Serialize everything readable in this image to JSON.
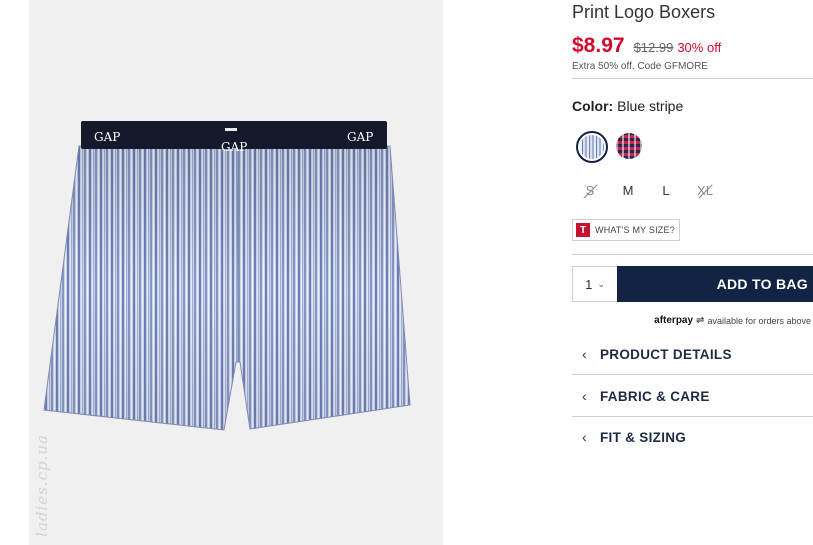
{
  "product": {
    "title": "Print Logo Boxers",
    "price": "$8.97",
    "original_price": "$12.99",
    "percent_off": "30% off",
    "promo": "Extra 50% off. Code GFMORE"
  },
  "image": {
    "waistband_text": [
      "GAP",
      "GAP",
      "GAP"
    ],
    "watermark": "ladies.cp.ua"
  },
  "color": {
    "label": "Color:",
    "value": "Blue stripe",
    "swatches": [
      {
        "name": "Blue stripe",
        "selected": true
      },
      {
        "name": "Plaid",
        "selected": false
      }
    ]
  },
  "sizes": [
    {
      "label": "S",
      "available": false
    },
    {
      "label": "M",
      "available": true
    },
    {
      "label": "L",
      "available": true
    },
    {
      "label": "XL",
      "available": false
    }
  ],
  "size_help": {
    "icon_text": "T",
    "label": "WHAT'S MY SIZE?"
  },
  "purchase": {
    "quantity": "1",
    "add_to_bag": "ADD TO BAG"
  },
  "afterpay": {
    "brand": "afterpay",
    "text": "available for orders above"
  },
  "accordions": [
    {
      "label": "PRODUCT DETAILS"
    },
    {
      "label": "FABRIC & CARE"
    },
    {
      "label": "FIT & SIZING"
    }
  ],
  "colors": {
    "price_red": "#d00a2c",
    "navy": "#122344",
    "stripe_blue": "#9fb0d4"
  }
}
